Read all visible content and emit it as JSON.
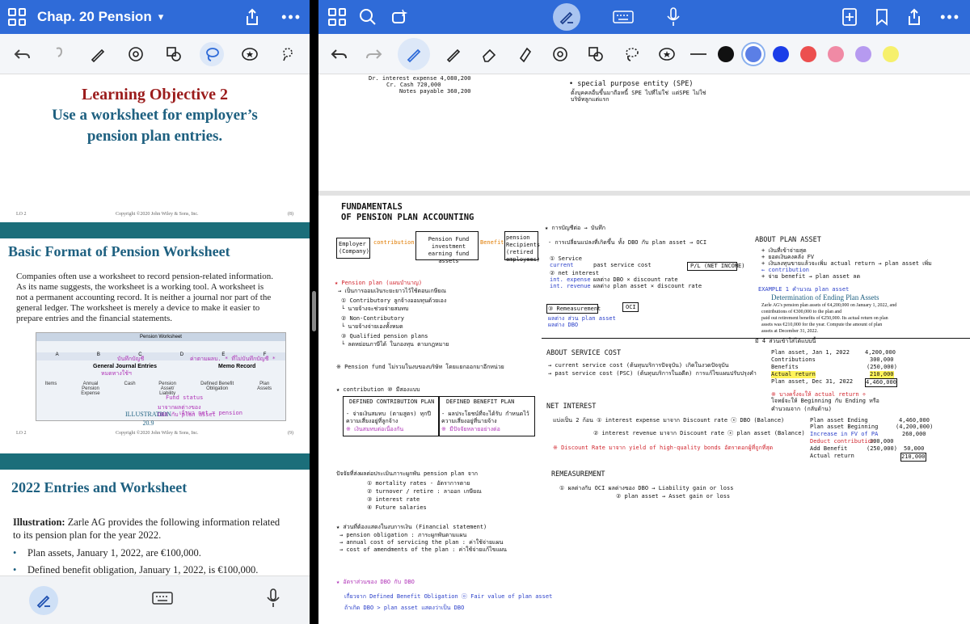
{
  "left": {
    "header": {
      "title": "Chap. 20 Pension"
    },
    "slides": {
      "s1": {
        "title": "Learning Objective 2",
        "subtitle_l1": "Use a worksheet for employer’s",
        "subtitle_l2": "pension plan entries.",
        "footer_lo": "LO 2",
        "footer_copy": "Copyright ©2020 John Wiley & Sons, Inc.",
        "footer_page": "(8)"
      },
      "s2": {
        "title": "Basic Format of Pension Worksheet",
        "para_l1": "Companies often use a worksheet to record pension-related information.",
        "para_l2": "As its name suggests, the worksheet is a working tool.  A worksheet is",
        "para_l3": "not a permanent accounting record.  It is neither a journal nor part of the",
        "para_l4": "general ledger. The worksheet is merely a device to make it easier to",
        "para_l5": "prepare entries and the financial statements.",
        "sheet_title": "Pension Worksheet",
        "sheet_cols": [
          "A",
          "B",
          "C",
          "D",
          "E",
          "F"
        ],
        "sheet_general": "General Journal Entries",
        "sheet_memo": "Memo Record",
        "sheet_headers": [
          "Items",
          "Annual Pension Expense",
          "Cash",
          "Pension Asset/ Liability",
          "Defined Benefit Obligation",
          "Plan Assets"
        ],
        "annot_1": "บันทึกบัญชี",
        "annot_2": "หมดทางใช้ฯ",
        "annot_3": "ค่าตามผลบ. * ที่ไม่บันทึกบัญชี *",
        "annot_4": "Fund status",
        "annot_5": "มาจากผลต่างของ",
        "annot_6": "DBO กับ plan asset",
        "annot_7": "เจ้ามา net = pension",
        "illus_1": "ILLUSTRATION",
        "illus_2": "20.9",
        "footer_lo": "LO 2",
        "footer_copy": "Copyright ©2020 John Wiley & Sons, Inc.",
        "footer_page": "(9)"
      },
      "s3": {
        "title": "2022 Entries and Worksheet",
        "illus_label": "Illustration:",
        "illus_text": "  Zarle AG provides the following information related",
        "illus_text2": "to its pension plan for the year 2022.",
        "bullets": [
          "Plan assets, January 1, 2022, are €100,000.",
          "Defined benefit obligation, January 1, 2022, is €100,000."
        ]
      }
    }
  },
  "right": {
    "page1": {
      "l1": "Dr. interest expense   4,080,200",
      "l2": "Cr. Cash                     720,000",
      "l3": "Notes payable             360,200",
      "spe1": "• special purpose entity (SPE)",
      "spe2": "ตั้งบุคคลอื่นขึ้นมาถือหนี้ SPE ไปที่ไม่ใช่ แต่SPE ไม่ใช่",
      "spe3": "บริษัทลูกแต่แรก"
    },
    "page2": {
      "title1": "FUNDAMENTALS",
      "title2": "OF PENSION PLAN ACCOUNTING",
      "employer": "Employer (Company)",
      "contribution": "contribution",
      "fund": "Pension Fund investment earning fund assets",
      "benefit": "Benefit",
      "recipients": "pension Recipients (retired employees)",
      "n1": "★ Pension plan (แผนบำนาญ)",
      "n2": "   → เป็นการออมเงินระยะยาวไว้ใช้ตอนเกษียณ",
      "n3": "① Contributory  ลูกจ้างออมทุนด้วยเอง",
      "n4": "   └ นายจ้างจะช่วยจ่ายสมทบ",
      "n5": "② Non-Contributory",
      "n6": "   └ นายจ้างจ่ายเองทั้งหมด",
      "n7": "③ Qualified pension plans",
      "n8": "   └ ลดหย่อนภาษีได้ ในกองทุน ตามกฎหมาย",
      "n9": "※ Pension fund ไม่รวมในงบของบริษัท โดยแยกออกมาอีกหน่วย",
      "n10": "★ contribution ⑩ มีสองแบบ",
      "dc": "DEFINED CONTRIBUTION PLAN",
      "db": "DEFINED BENEFIT PLAN",
      "dc1": "- จ่ายเงินสมทบ (ตามสูตร) ทุกปี",
      "dc2": "  ความเสี่ยงอยู่ที่ลูกจ้าง",
      "dc3": "※ เงินสมทบต่อเนื่องกัน",
      "db1": "- ผลประโยชน์ที่จะได้รับ กำหนดไว้",
      "db2": "  ความเสี่ยงอยู่ที่นายจ้าง",
      "db3": "※ มีปัจจัยหลายอย่างต่อ",
      "m1": "ปัจจัยที่ส่งผลต่อประเมินภาระผูกพัน pension plan จาก",
      "m2": "① mortality rates - อัตราการตาย",
      "m3": "② turnover / retire : ลาออก เกษียณ",
      "m4": "③ interest rate",
      "m5": "④ Future salaries",
      "f1": "★ ส่วนที่ต้องแสดงในงบการเงิน (Financial statement)",
      "f2": "  → pension obligation : ภาระผูกพันตามแผน",
      "f3": "  → annual cost of servicing the plan : ค่าใช้จ่ายแผน",
      "f4": "  → cost of amendments of the plan : ค่าใช้จ่ายแก้ไขแผน",
      "g1": "★ อัตราส่วนของ DBO กับ DBO",
      "g2": "เกี่ยวจาก Defined Benefit Obligation ⓞ Fair value of plan asset",
      "g3": "ถ้าเกิด DBO > plan asset แสดงว่าเป็น DBO",
      "c1": "★ การบัญชีต่อ → บันทึก",
      "c2": "- การเปลี่ยนแปลงที่เกิดขึ้น ทั้ง DBO กับ plan asset → OCI",
      "c3": "① Service",
      "c4": "   current",
      "c5": "   past service cost",
      "c6": "② net interest",
      "c7": "   int. expense",
      "c8": "   int. revenue",
      "c9": "   ผลต่าง DBO × discount rate",
      "c10": "   ผลต่าง plan asset × discount rate",
      "c11": "P/L (NET INCOME)",
      "c12": "③ Remeasurement",
      "c13": "OCI",
      "c14": "ผลต่าง ส่วน plan asset",
      "c15": "ผลต่าง DBO",
      "as1": "ABOUT SERVICE COST",
      "as2": "→ current service cost (ต้นทุนบริการปัจจุบัน) เกิดในงวดปัจจุบัน",
      "as3": "→ past service cost (PSC) (ต้นทุนบริการในอดีต) การแก้ไขแผนปรับปรุงคำ",
      "ni1": "NET INTEREST",
      "ni2": "แบ่งเป็น 2 ก้อน  ① interest expense มาจาก Discount rate ⓧ DBO (Balance)",
      "ni3": "② interest revenue มาจาก Discount rate ⓧ plan asset (Balance)",
      "ni4": "※ Discount Rate มาจาก yield of high-quality bonds อัตราดอกผู้ที่ถูกที่สุด",
      "re1": "REMEASUREMENT",
      "re2": "① ผลต่างกับ OCI  ผลต่างของ DBO → Liability gain or loss",
      "re3": "② plan asset → Asset gain or loss",
      "ap1": "ABOUT PLAN ASSET",
      "ap2": "+ เงินที่เข้าจ่ายสุด",
      "ap3": "+ ยอดเงินคงคลัง FV",
      "ap4": "+ เงินลงทุนขายแล้วจะเพิ่ม actual return → plan asset เพิ่ม",
      "ap5": "  ← contribution",
      "ap6": "+ จ่าย benefit → plan asset ลด",
      "ex1": "EXAMPLE 1 คำนวณ plan asset",
      "ex2": "Determination of Ending Plan Assets",
      "ex3": "Zarle AG's pension plan assets of €4,200,000 on January 1, 2022, and contributions of €300,000 to the plan and",
      "ex4": "paid out retirement benefits of €250,000. Its actual return on plan",
      "ex5": "assets was €210,000 for the year. Compute the amount of plan",
      "ex6": "assets at December 31, 2022.",
      "ex7": "มี 4 ส่วนเข้าใส่ได้แบบนี้",
      "ex8": "Plan asset, Jan 1, 2022",
      "ex9": "Contributions",
      "ex10": "Benefits",
      "ex11": "Actual return",
      "ex12": "Plan asset, Dec 31, 2022",
      "ex13": "4,200,000",
      "ex14": "300,000",
      "ex15": "(250,000)",
      "ex16": "210,000",
      "ex17": "4,460,000",
      "ex18": "※ บางครั้งจะให้ actual return ÷",
      "ex19": "โจทย์จะให้ Beginning กับ Ending หรือ",
      "ex20": "คำนวณจาก (กลับด้าน)",
      "ex21": "Plan asset Ending",
      "ex22": "Plan asset Beginning",
      "ex23": "Increase in FV of PA",
      "ex24": "Deduct contribution",
      "ex25": "Add  Benefit",
      "ex26": "Actual return",
      "ex27": "4,460,000",
      "ex28": "(4,200,000)",
      "ex29": "260,000",
      "ex30": "300,000",
      "ex31": "(250,000)",
      "ex32": "50,000",
      "ex33": "210,000"
    }
  }
}
